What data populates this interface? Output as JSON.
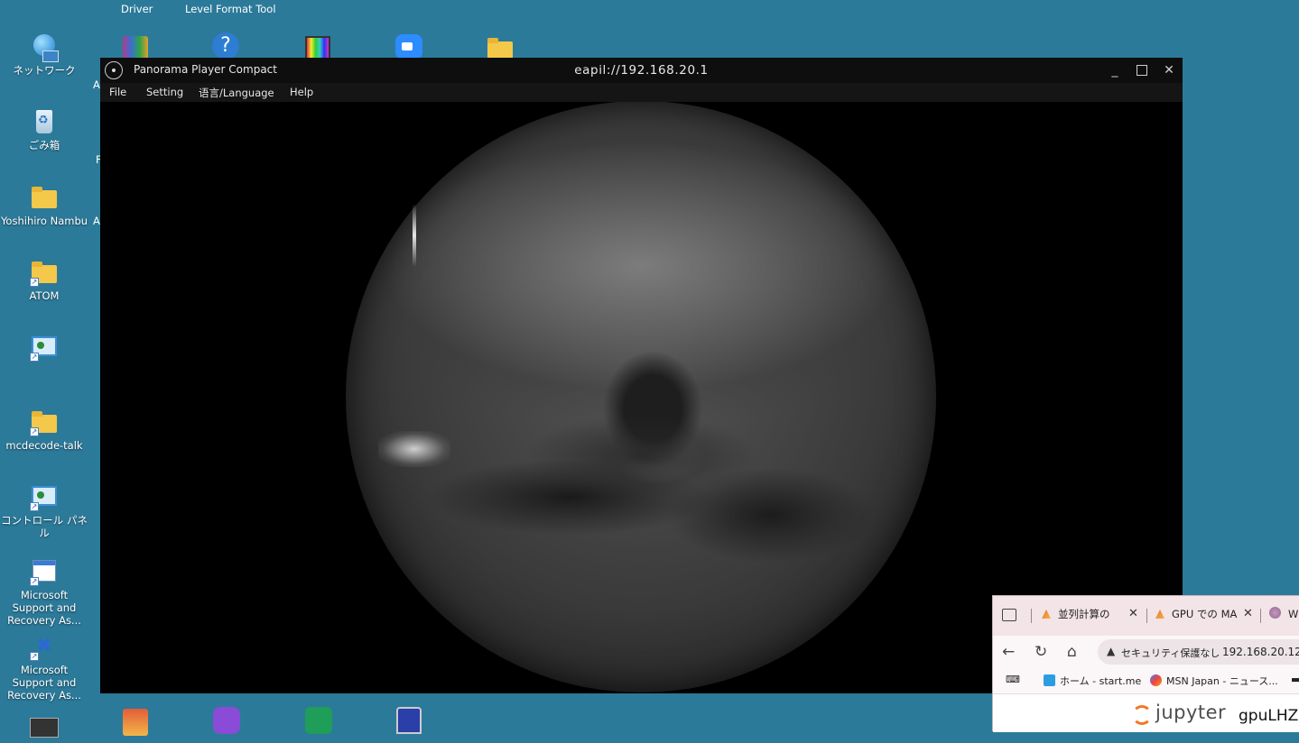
{
  "desktop": {
    "background_color": "#2c7a9a",
    "top_labels": [
      "Driver",
      "Level Format Tool"
    ],
    "icons": [
      {
        "label": "ネットワーク",
        "icon": "network-icon"
      },
      {
        "label": "ごみ箱",
        "icon": "recycle-bin-icon"
      },
      {
        "label": "Yoshihiro Nambu",
        "icon": "folder-icon"
      },
      {
        "label": "ATOM",
        "icon": "folder-icon"
      },
      {
        "label": "",
        "icon": "control-panel-icon"
      },
      {
        "label": "mcdecode-talk",
        "icon": "folder-icon"
      },
      {
        "label": "コントロール パネル",
        "icon": "control-panel-icon"
      },
      {
        "label": "Microsoft Support and Recovery As...",
        "icon": "app-window-icon"
      },
      {
        "label": "Microsoft Support and Recovery As...",
        "icon": "tools-icon"
      }
    ],
    "clipped_letters": [
      "A",
      "F",
      "A"
    ]
  },
  "app_window": {
    "app_name": "Panorama Player Compact",
    "title": "eapil://192.168.20.1",
    "controls": {
      "minimize": "_",
      "maximize": "",
      "close": "✕"
    },
    "menu": [
      "File",
      "Setting",
      "语言/Language",
      "Help"
    ]
  },
  "browser": {
    "tabs": [
      {
        "title": "並列計算の"
      },
      {
        "title": "GPU での MA"
      },
      {
        "title": "W"
      }
    ],
    "tab_close": "✕",
    "nav": {
      "back": "←",
      "reload": "↻",
      "home": "⌂"
    },
    "address": {
      "warning": "▲",
      "security_text": "セキュリティ保護なし",
      "url": "192.168.20.12"
    },
    "bookmarks": [
      {
        "label": "ホーム - start.me"
      },
      {
        "label": "MSN Japan - ニュース..."
      }
    ],
    "jupyter": {
      "logo_text": "jupyter",
      "notebook_name": "gpuLHZE"
    }
  }
}
